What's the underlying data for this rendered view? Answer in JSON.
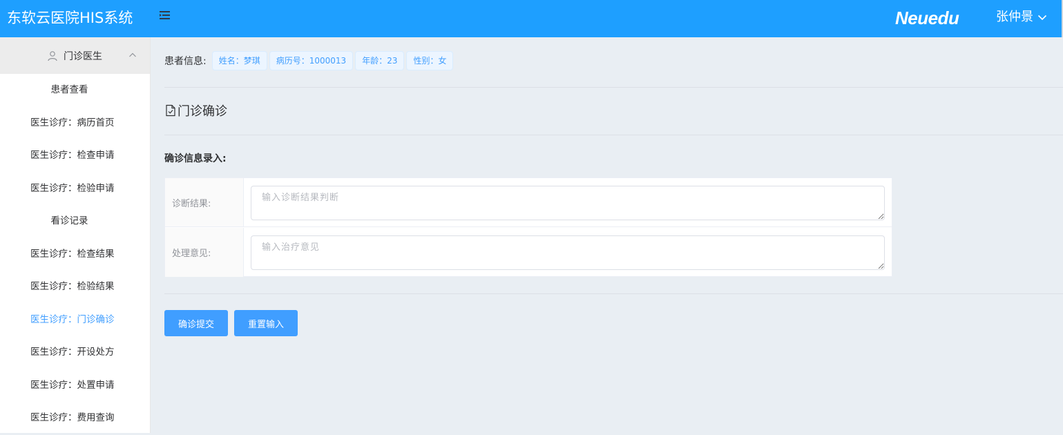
{
  "header": {
    "app_title": "东软云医院HIS系统",
    "brand": "Neuedu",
    "user_name": "张仲景",
    "accent_color": "#1e9fff"
  },
  "sidebar": {
    "group_title": "门诊医生",
    "items": [
      {
        "label": "患者查看"
      },
      {
        "label": "医生诊疗：病历首页"
      },
      {
        "label": "医生诊疗：检查申请"
      },
      {
        "label": "医生诊疗：检验申请"
      },
      {
        "label": "看诊记录"
      },
      {
        "label": "医生诊疗：检查结果"
      },
      {
        "label": "医生诊疗：检验结果"
      },
      {
        "label": "医生诊疗：门诊确诊"
      },
      {
        "label": "医生诊疗：开设处方"
      },
      {
        "label": "医生诊疗：处置申请"
      },
      {
        "label": "医生诊疗：费用查询"
      }
    ],
    "active_color": "#409eff"
  },
  "patient": {
    "label": "患者信息:",
    "tags": [
      "姓名：梦琪",
      "病历号：1000013",
      "年龄：23",
      "性别：女"
    ]
  },
  "page": {
    "title": "门诊确诊",
    "form_heading": "确诊信息录入:"
  },
  "form": {
    "diagnosis_label": "诊断结果:",
    "diagnosis_value": "",
    "diagnosis_placeholder": "输入诊断结果判断",
    "treatment_label": "处理意见:",
    "treatment_value": "",
    "treatment_placeholder": "输入治疗意见"
  },
  "buttons": {
    "submit": "确诊提交",
    "reset": "重置输入"
  }
}
